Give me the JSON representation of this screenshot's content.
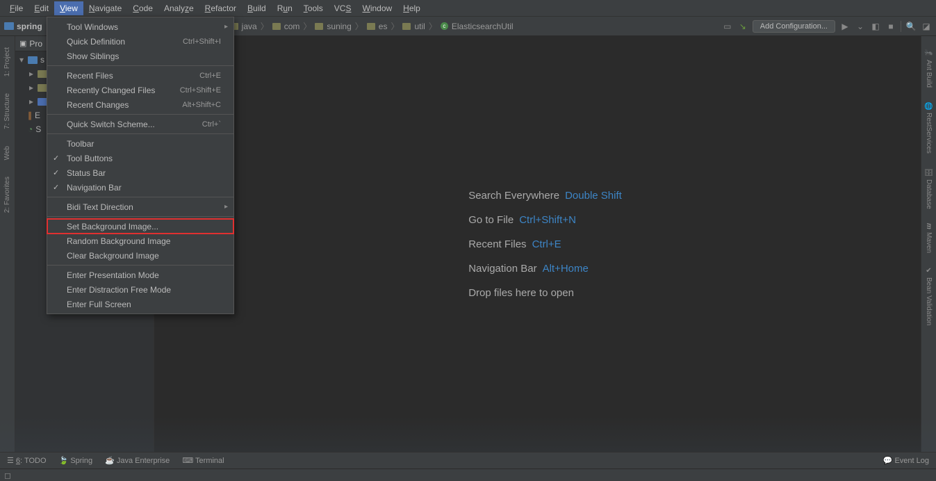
{
  "menubar": {
    "items": [
      "File",
      "Edit",
      "View",
      "Navigate",
      "Code",
      "Analyze",
      "Refactor",
      "Build",
      "Run",
      "Tools",
      "VCS",
      "Window",
      "Help"
    ],
    "active": "View"
  },
  "navbar": {
    "project_name": "spring",
    "breadcrumb": [
      "java",
      "com",
      "suning",
      "es",
      "util",
      "ElasticsearchUtil"
    ],
    "add_config": "Add Configuration..."
  },
  "dropdown": {
    "items": [
      {
        "label": "Tool Windows",
        "shortcut": "",
        "arrow": true
      },
      {
        "label": "Quick Definition",
        "shortcut": "Ctrl+Shift+I"
      },
      {
        "label": "Show Siblings",
        "shortcut": ""
      },
      {
        "sep": true
      },
      {
        "label": "Recent Files",
        "shortcut": "Ctrl+E"
      },
      {
        "label": "Recently Changed Files",
        "shortcut": "Ctrl+Shift+E"
      },
      {
        "label": "Recent Changes",
        "shortcut": "Alt+Shift+C"
      },
      {
        "sep": true
      },
      {
        "label": "Quick Switch Scheme...",
        "shortcut": "Ctrl+`"
      },
      {
        "sep": true
      },
      {
        "label": "Toolbar",
        "shortcut": ""
      },
      {
        "label": "Tool Buttons",
        "shortcut": "",
        "check": true
      },
      {
        "label": "Status Bar",
        "shortcut": "",
        "check": true
      },
      {
        "label": "Navigation Bar",
        "shortcut": "",
        "check": true
      },
      {
        "sep": true
      },
      {
        "label": "Bidi Text Direction",
        "shortcut": "",
        "arrow": true
      },
      {
        "sep": true
      },
      {
        "label": "Set Background Image...",
        "shortcut": "",
        "highlight": true
      },
      {
        "label": "Random Background Image",
        "shortcut": ""
      },
      {
        "label": "Clear Background Image",
        "shortcut": ""
      },
      {
        "sep": true
      },
      {
        "label": "Enter Presentation Mode",
        "shortcut": ""
      },
      {
        "label": "Enter Distraction Free Mode",
        "shortcut": ""
      },
      {
        "label": "Enter Full Screen",
        "shortcut": ""
      }
    ]
  },
  "projtool": {
    "header": "Pro",
    "rows": [
      "s",
      "",
      "",
      "E",
      "S"
    ]
  },
  "leftbar": {
    "items": [
      "1: Project",
      "7: Structure",
      "Web",
      "2: Favorites"
    ]
  },
  "rightbar": {
    "items": [
      "Ant Build",
      "RestServices",
      "Database",
      "Maven",
      "Bean Validation"
    ]
  },
  "placeholder": {
    "rows": [
      {
        "lbl": "Search Everywhere",
        "key": "Double Shift"
      },
      {
        "lbl": "Go to File",
        "key": "Ctrl+Shift+N"
      },
      {
        "lbl": "Recent Files",
        "key": "Ctrl+E"
      },
      {
        "lbl": "Navigation Bar",
        "key": "Alt+Home"
      },
      {
        "lbl": "Drop files here to open",
        "key": ""
      }
    ]
  },
  "toolrow": {
    "items": [
      "6: TODO",
      "Spring",
      "Java Enterprise",
      "Terminal"
    ],
    "event_log": "Event Log"
  }
}
